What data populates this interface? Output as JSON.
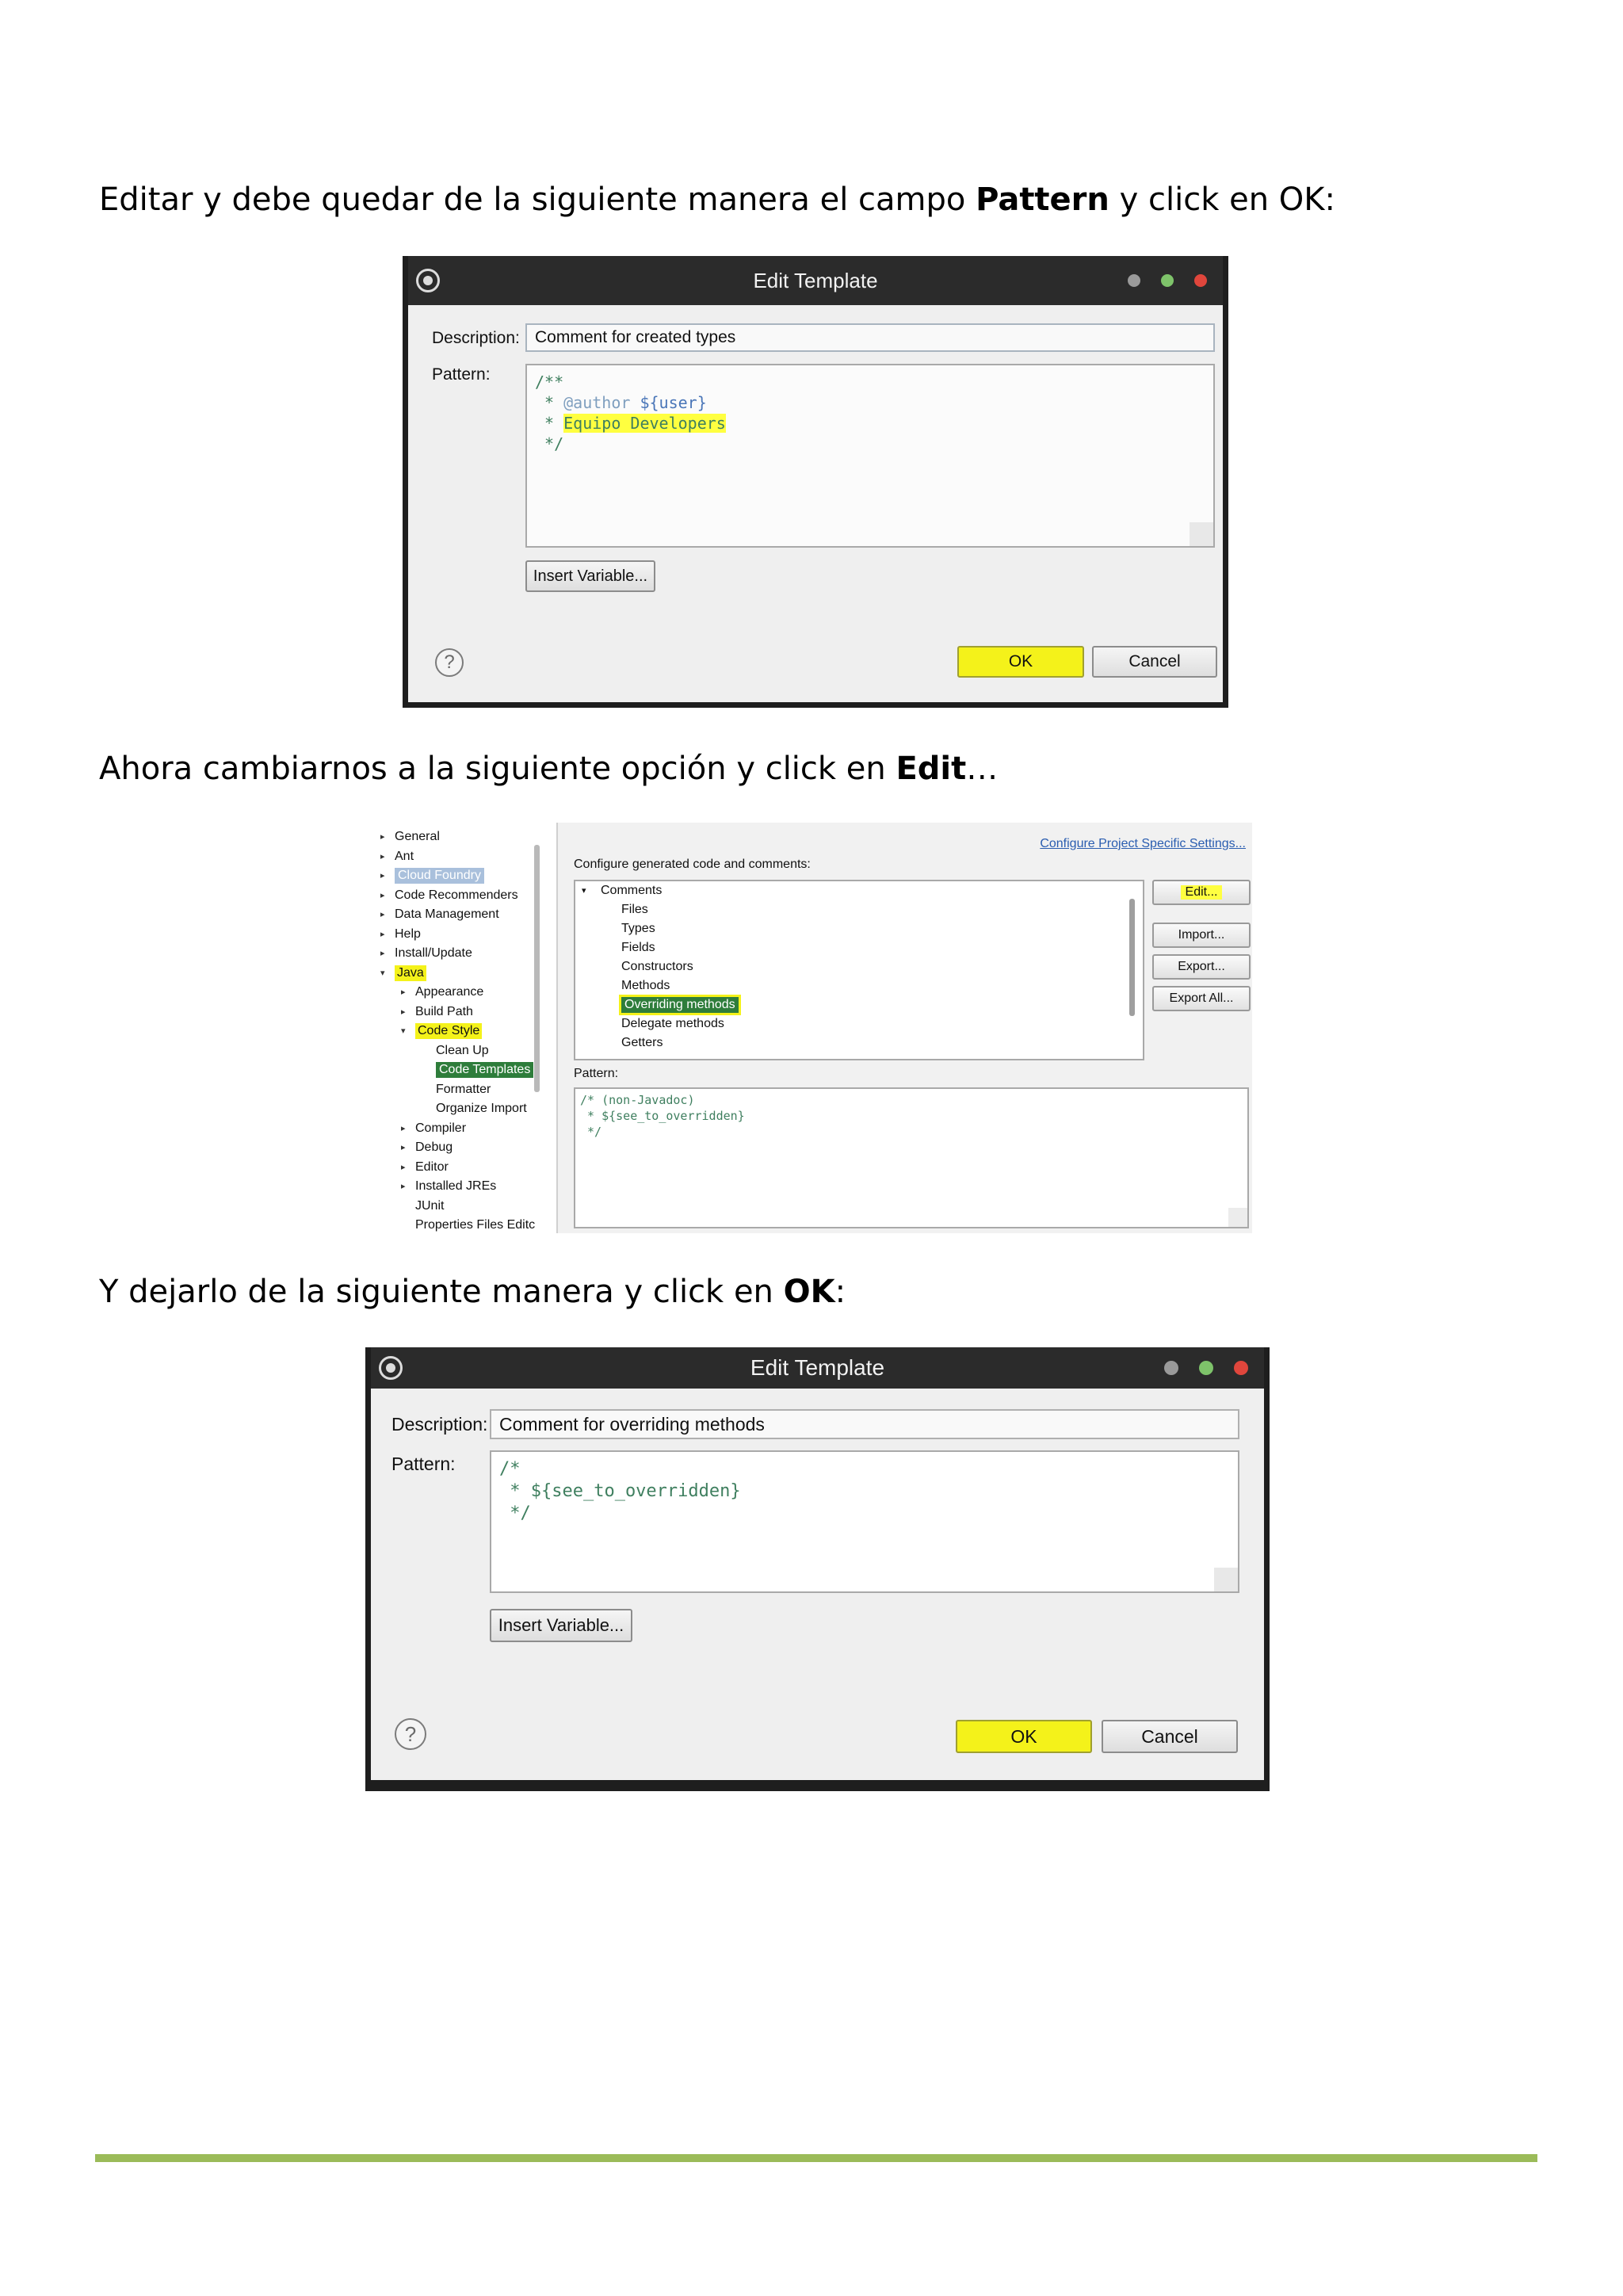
{
  "paragraphs": {
    "p1_before": "Editar y debe quedar de la siguiente manera el campo ",
    "p1_bold": "Pattern",
    "p1_after": " y click en OK:",
    "p2_before": "Ahora cambiarnos a la siguiente opción y click en ",
    "p2_bold": "Edit",
    "p2_after": "…",
    "p3_before": "Y dejarlo de la siguiente manera y click en ",
    "p3_bold": "OK",
    "p3_after": ":"
  },
  "dialog1": {
    "title": "Edit Template",
    "description_label": "Description:",
    "description_value": "Comment for created types",
    "pattern_label": "Pattern:",
    "pattern_line1": "/**",
    "pattern_line2_prefix": " * ",
    "pattern_line2_tag": "@author",
    "pattern_line2_var": " ${user}",
    "pattern_line3_prefix": " * ",
    "pattern_line3_text": "Equipo Developers",
    "pattern_line4": " */",
    "insert_variable": "Insert Variable...",
    "ok": "OK",
    "cancel": "Cancel",
    "help": "?"
  },
  "preferences": {
    "tree": [
      {
        "label": "General",
        "level": 0,
        "arrow": "▸"
      },
      {
        "label": "Ant",
        "level": 0,
        "arrow": "▸"
      },
      {
        "label": "Cloud Foundry",
        "level": 0,
        "arrow": "▸"
      },
      {
        "label": "Code Recommenders",
        "level": 0,
        "arrow": "▸"
      },
      {
        "label": "Data Management",
        "level": 0,
        "arrow": "▸"
      },
      {
        "label": "Help",
        "level": 0,
        "arrow": "▸"
      },
      {
        "label": "Install/Update",
        "level": 0,
        "arrow": "▸"
      },
      {
        "label": "Java",
        "level": 0,
        "arrow": "▾"
      },
      {
        "label": "Appearance",
        "level": 1,
        "arrow": "▸"
      },
      {
        "label": "Build Path",
        "level": 1,
        "arrow": "▸"
      },
      {
        "label": "Code Style",
        "level": 1,
        "arrow": "▾"
      },
      {
        "label": "Clean Up",
        "level": 2,
        "arrow": ""
      },
      {
        "label": "Code Templates",
        "level": 2,
        "arrow": ""
      },
      {
        "label": "Formatter",
        "level": 2,
        "arrow": ""
      },
      {
        "label": "Organize Import",
        "level": 2,
        "arrow": ""
      },
      {
        "label": "Compiler",
        "level": 1,
        "arrow": "▸"
      },
      {
        "label": "Debug",
        "level": 1,
        "arrow": "▸"
      },
      {
        "label": "Editor",
        "level": 1,
        "arrow": "▸"
      },
      {
        "label": "Installed JREs",
        "level": 1,
        "arrow": "▸"
      },
      {
        "label": "JUnit",
        "level": 1,
        "arrow": ""
      },
      {
        "label": "Properties Files Editc",
        "level": 1,
        "arrow": ""
      }
    ],
    "configure_link": "Configure Project Specific Settings...",
    "configure_label": "Configure generated code and comments:",
    "list": [
      {
        "label": "Comments",
        "level": 0,
        "arrow": "▾"
      },
      {
        "label": "Files",
        "level": 1,
        "arrow": ""
      },
      {
        "label": "Types",
        "level": 1,
        "arrow": ""
      },
      {
        "label": "Fields",
        "level": 1,
        "arrow": ""
      },
      {
        "label": "Constructors",
        "level": 1,
        "arrow": ""
      },
      {
        "label": "Methods",
        "level": 1,
        "arrow": ""
      },
      {
        "label": "Overriding methods",
        "level": 1,
        "arrow": ""
      },
      {
        "label": "Delegate methods",
        "level": 1,
        "arrow": ""
      },
      {
        "label": "Getters",
        "level": 1,
        "arrow": ""
      }
    ],
    "buttons": {
      "edit": "Edit...",
      "import": "Import...",
      "export": "Export...",
      "export_all": "Export All..."
    },
    "pattern_label": "Pattern:",
    "pattern_lines": [
      "/* (non-Javadoc)",
      " * ${see_to_overridden}",
      " */"
    ]
  },
  "dialog2": {
    "title": "Edit Template",
    "description_label": "Description:",
    "description_value": "Comment for overriding methods",
    "pattern_label": "Pattern:",
    "pattern_line1": "/*",
    "pattern_line2": " * ${see_to_overridden}",
    "pattern_line3": " */",
    "insert_variable": "Insert Variable...",
    "ok": "OK",
    "cancel": "Cancel",
    "help": "?"
  },
  "colors": {
    "highlight": "#f4f21a",
    "rule": "#9bbb59",
    "titlebar": "#2b2b2b",
    "selection_blue": "#a9c0dc",
    "selection_green": "#2e7d3b"
  }
}
